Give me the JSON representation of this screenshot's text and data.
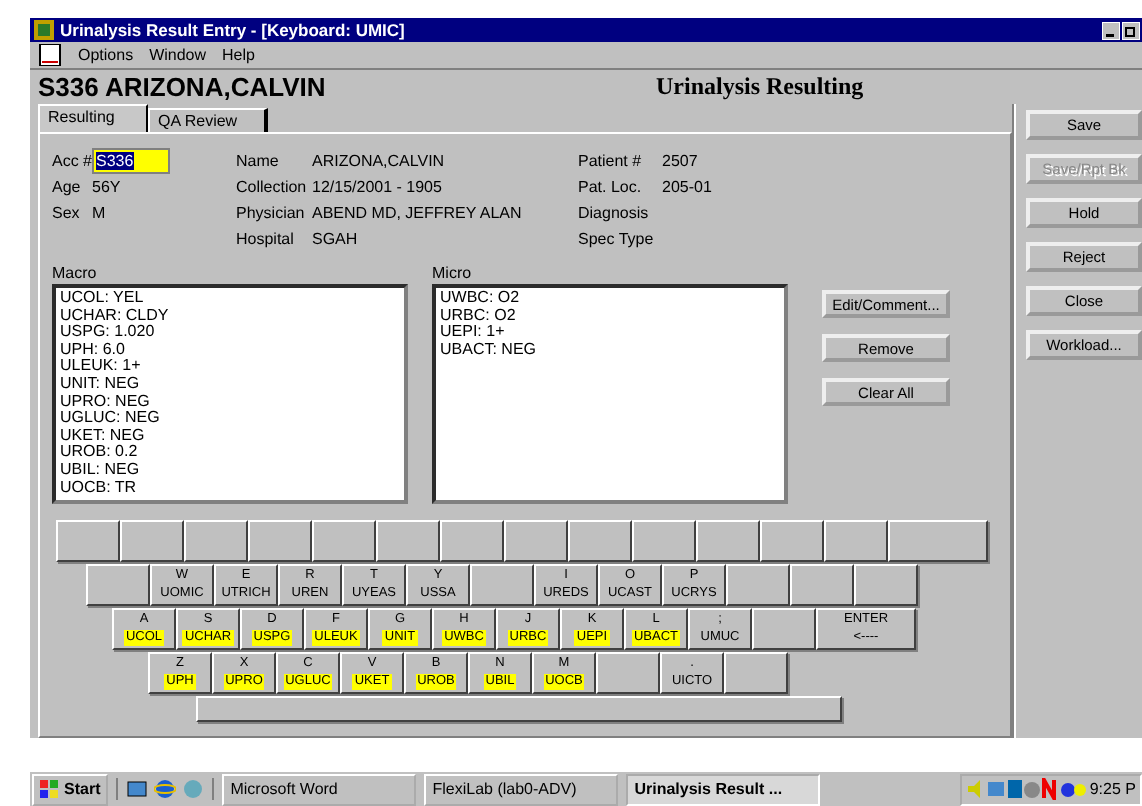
{
  "window": {
    "title": "Urinalysis Result Entry - [Keyboard: UMIC]"
  },
  "menu": [
    "Options",
    "Window",
    "Help"
  ],
  "header": {
    "patient": "S336 ARIZONA,CALVIN",
    "screen": "Urinalysis Resulting"
  },
  "tabs": [
    {
      "label": "Resulting",
      "selected": true
    },
    {
      "label": "QA Review",
      "selected": false
    }
  ],
  "acc": {
    "label": "Acc #",
    "value": "S336"
  },
  "left_info": [
    {
      "label": "Age",
      "value": "56Y"
    },
    {
      "label": "Sex",
      "value": "M"
    }
  ],
  "mid_info": [
    {
      "label": "Name",
      "value": "ARIZONA,CALVIN"
    },
    {
      "label": "Collection",
      "value": "12/15/2001 - 1905"
    },
    {
      "label": "Physician",
      "value": "ABEND MD, JEFFREY ALAN"
    },
    {
      "label": "Hospital",
      "value": "SGAH"
    }
  ],
  "right_info": [
    {
      "label": "Patient #",
      "value": "2507"
    },
    {
      "label": "Pat. Loc.",
      "value": "205-01"
    },
    {
      "label": "Diagnosis"
    },
    {
      "label": "Spec Type"
    }
  ],
  "macro": {
    "label": "Macro",
    "items": [
      "UCOL: YEL",
      "UCHAR: CLDY",
      "USPG: 1.020",
      "UPH: 6.0",
      "ULEUK: 1+",
      "UNIT: NEG",
      "UPRO: NEG",
      "UGLUC: NEG",
      "UKET: NEG",
      "UROB: 0.2",
      "UBIL: NEG",
      "UOCB: TR"
    ]
  },
  "micro": {
    "label": "Micro",
    "items": [
      "UWBC: O2",
      "URBC: O2",
      "UEPI: 1+",
      "UBACT: NEG"
    ]
  },
  "list_buttons": [
    "Edit/Comment...",
    "Remove",
    "Clear All"
  ],
  "side_buttons": [
    {
      "label": "Save",
      "disabled": false
    },
    {
      "label": "Save/Rpt Bk",
      "disabled": true
    },
    {
      "label": "Hold",
      "disabled": false
    },
    {
      "label": "Reject",
      "disabled": false
    },
    {
      "label": "Close",
      "disabled": false
    },
    {
      "label": "Workload...",
      "disabled": false
    }
  ],
  "keyboard": [
    [
      {
        "kind": "blank"
      },
      {
        "kind": "blank"
      },
      {
        "kind": "blank"
      },
      {
        "kind": "blank"
      },
      {
        "kind": "blank"
      },
      {
        "kind": "blank"
      },
      {
        "kind": "blank"
      },
      {
        "kind": "blank"
      },
      {
        "kind": "blank"
      },
      {
        "kind": "blank"
      },
      {
        "kind": "blank"
      },
      {
        "kind": "blank"
      },
      {
        "kind": "blank"
      },
      {
        "kind": "blank"
      }
    ],
    [
      {
        "kind": "blank"
      },
      {
        "kind": "key",
        "key": "W",
        "test": "UOMIC",
        "highlighted": false
      },
      {
        "kind": "key",
        "key": "E",
        "test": "UTRICH",
        "highlighted": false
      },
      {
        "kind": "key",
        "key": "R",
        "test": "UREN",
        "highlighted": false
      },
      {
        "kind": "key",
        "key": "T",
        "test": "UYEAS",
        "highlighted": false
      },
      {
        "kind": "key",
        "key": "Y",
        "test": "USSA",
        "highlighted": false
      },
      {
        "kind": "blank"
      },
      {
        "kind": "key",
        "key": "I",
        "test": "UREDS",
        "highlighted": false
      },
      {
        "kind": "key",
        "key": "O",
        "test": "UCAST",
        "highlighted": false
      },
      {
        "kind": "key",
        "key": "P",
        "test": "UCRYS",
        "highlighted": false
      },
      {
        "kind": "blank"
      },
      {
        "kind": "blank"
      },
      {
        "kind": "blank"
      }
    ],
    [
      {
        "kind": "key",
        "key": "A",
        "test": "UCOL",
        "highlighted": true
      },
      {
        "kind": "key",
        "key": "S",
        "test": "UCHAR",
        "highlighted": true
      },
      {
        "kind": "key",
        "key": "D",
        "test": "USPG",
        "highlighted": true
      },
      {
        "kind": "key",
        "key": "F",
        "test": "ULEUK",
        "highlighted": true
      },
      {
        "kind": "key",
        "key": "G",
        "test": "UNIT",
        "highlighted": true
      },
      {
        "kind": "key",
        "key": "H",
        "test": "UWBC",
        "highlighted": true
      },
      {
        "kind": "key",
        "key": "J",
        "test": "URBC",
        "highlighted": true
      },
      {
        "kind": "key",
        "key": "K",
        "test": "UEPI",
        "highlighted": true
      },
      {
        "kind": "key",
        "key": "L",
        "test": "UBACT",
        "highlighted": true
      },
      {
        "kind": "key",
        "key": ";",
        "test": "UMUC",
        "highlighted": false
      },
      {
        "kind": "blank"
      },
      {
        "kind": "enter",
        "key": "ENTER",
        "test": "<----"
      }
    ],
    [
      {
        "kind": "key",
        "key": "Z",
        "test": "UPH",
        "highlighted": true
      },
      {
        "kind": "key",
        "key": "X",
        "test": "UPRO",
        "highlighted": true
      },
      {
        "kind": "key",
        "key": "C",
        "test": "UGLUC",
        "highlighted": true
      },
      {
        "kind": "key",
        "key": "V",
        "test": "UKET",
        "highlighted": true
      },
      {
        "kind": "key",
        "key": "B",
        "test": "UROB",
        "highlighted": true
      },
      {
        "kind": "key",
        "key": "N",
        "test": "UBIL",
        "highlighted": true
      },
      {
        "kind": "key",
        "key": "M",
        "test": "UOCB",
        "highlighted": true
      },
      {
        "kind": "blank"
      },
      {
        "kind": "key",
        "key": ".",
        "test": "UICTO",
        "highlighted": false
      },
      {
        "kind": "blank"
      }
    ],
    [
      {
        "kind": "space"
      }
    ]
  ],
  "taskbar": {
    "start": "Start",
    "tasks": [
      {
        "label": "Microsoft Word",
        "selected": false
      },
      {
        "label": "FlexiLab (lab0-ADV)",
        "selected": false
      },
      {
        "label": "Urinalysis Result ...",
        "selected": true
      }
    ],
    "clock": "9:25 P"
  }
}
